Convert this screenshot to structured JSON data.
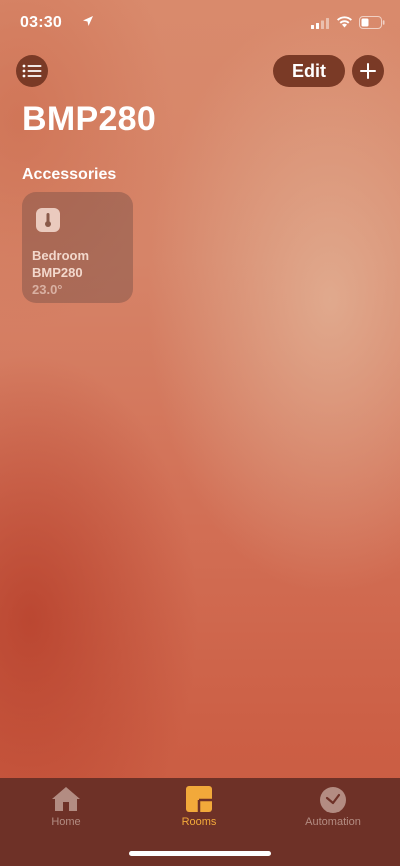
{
  "status_bar": {
    "time": "03:30"
  },
  "header": {
    "edit_label": "Edit",
    "title": "BMP280"
  },
  "section": {
    "label": "Accessories"
  },
  "accessory": {
    "room": "Bedroom",
    "name": "BMP280",
    "value": "23.0°"
  },
  "tab_bar": {
    "tabs": [
      {
        "label": "Home"
      },
      {
        "label": "Rooms"
      },
      {
        "label": "Automation"
      }
    ],
    "active": "Rooms",
    "active_color": "#f2a93a",
    "inactive_color": "#b38c82"
  },
  "colors": {
    "button_bg": "#7a3a26",
    "tab_bar_bg": "#6e3127"
  }
}
